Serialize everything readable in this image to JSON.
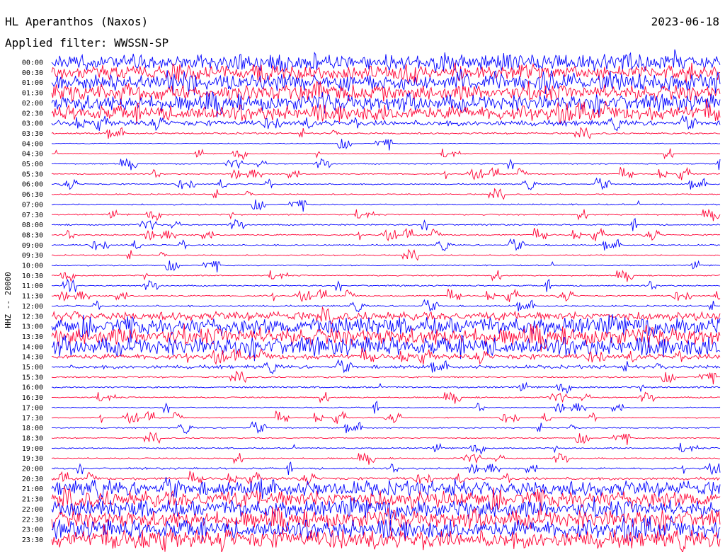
{
  "header": {
    "station": "HL Aperanthos (Naxos)",
    "date": "2023-06-18",
    "filter": "Applied filter: WWSSN-SP"
  },
  "chart_data": {
    "type": "line",
    "title": "HL Aperanthos (Naxos)",
    "date": "2023-06-18",
    "filter": "WWSSN-SP",
    "ylabel": "HHZ -- 20000",
    "colors": {
      "even_rows": "#0000ff",
      "odd_rows": "#ff0033"
    },
    "row_labels": [
      "00:00",
      "00:30",
      "01:00",
      "01:30",
      "02:00",
      "02:30",
      "03:00",
      "03:30",
      "04:00",
      "04:30",
      "05:00",
      "05:30",
      "06:00",
      "06:30",
      "07:00",
      "07:30",
      "08:00",
      "08:30",
      "09:00",
      "09:30",
      "10:00",
      "10:30",
      "11:00",
      "11:30",
      "12:00",
      "12:30",
      "13:00",
      "13:30",
      "14:00",
      "14:30",
      "15:00",
      "15:30",
      "16:00",
      "16:30",
      "17:00",
      "17:30",
      "18:00",
      "18:30",
      "19:00",
      "19:30",
      "20:00",
      "20:30",
      "21:00",
      "21:30",
      "22:00",
      "22:30",
      "23:00",
      "23:30"
    ],
    "noise_level": [
      9,
      8,
      9,
      9,
      9,
      8,
      3,
      1,
      0.5,
      0.5,
      0.6,
      0.6,
      0.7,
      0.7,
      0.8,
      0.8,
      0.8,
      0.8,
      0.8,
      0.7,
      0.7,
      0.7,
      0.8,
      0.8,
      1,
      5,
      10,
      10,
      10,
      3,
      2,
      1,
      1,
      0.8,
      0.6,
      0.6,
      0.7,
      0.7,
      0.8,
      0.8,
      1,
      1.5,
      9,
      10,
      10,
      10,
      10,
      10
    ]
  }
}
